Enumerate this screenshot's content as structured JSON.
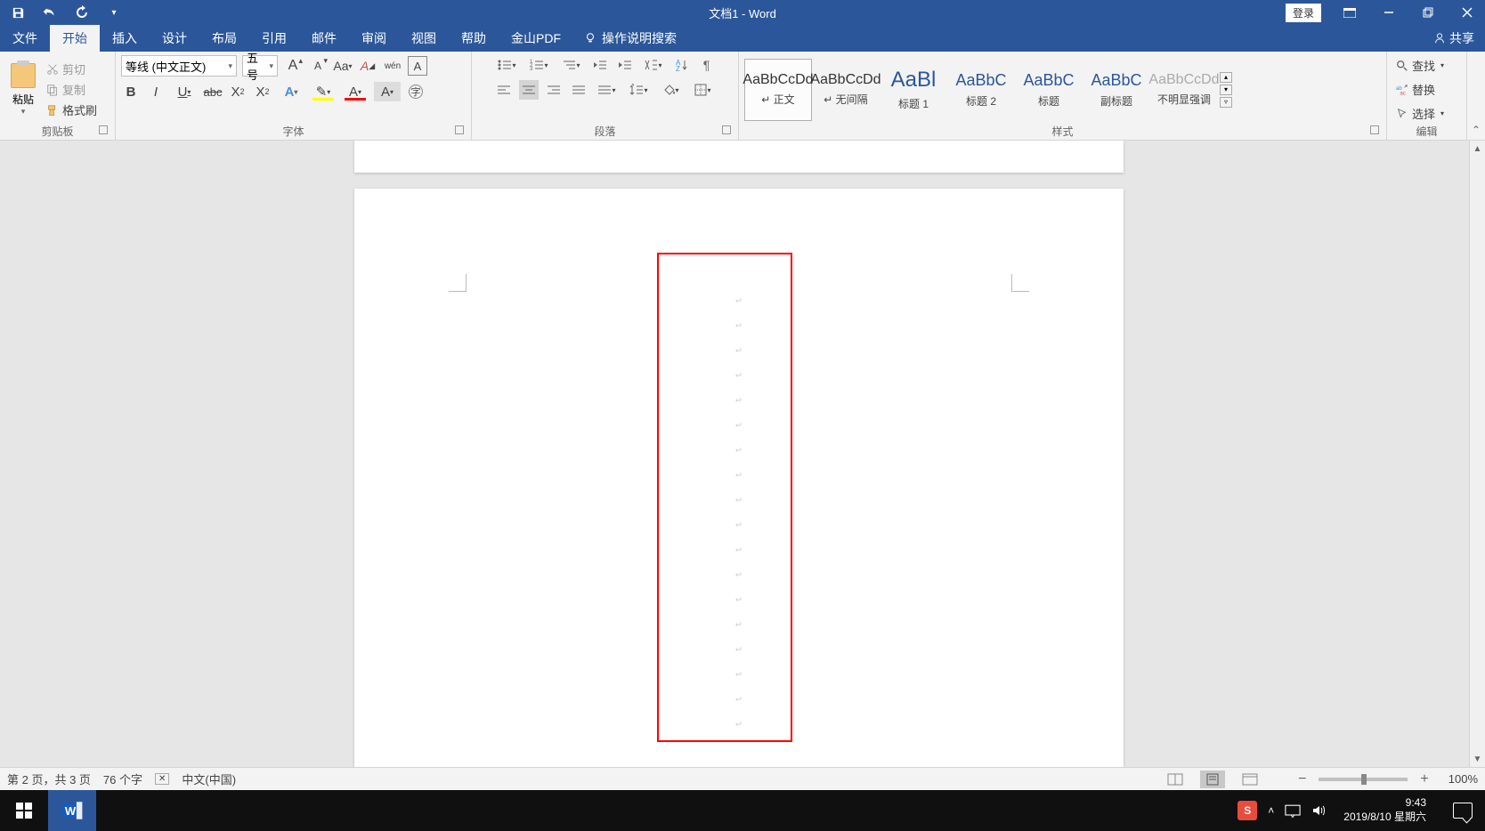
{
  "titlebar": {
    "title": "文档1 - Word",
    "login": "登录"
  },
  "tabs": {
    "file": "文件",
    "home": "开始",
    "insert": "插入",
    "design": "设计",
    "layout": "布局",
    "references": "引用",
    "mailings": "邮件",
    "review": "审阅",
    "view": "视图",
    "help": "帮助",
    "jinshan": "金山PDF",
    "tell_me": "操作说明搜索",
    "share": "共享"
  },
  "ribbon": {
    "clipboard": {
      "label": "剪贴板",
      "paste": "粘贴",
      "cut": "剪切",
      "copy": "复制",
      "format_painter": "格式刷"
    },
    "font": {
      "label": "字体",
      "name": "等线 (中文正文)",
      "size": "五号"
    },
    "paragraph": {
      "label": "段落"
    },
    "styles": {
      "label": "样式",
      "items": [
        {
          "preview": "AaBbCcDd",
          "name": "正文",
          "cls": "",
          "selected": true,
          "prefix": "↵"
        },
        {
          "preview": "AaBbCcDd",
          "name": "无间隔",
          "cls": "",
          "selected": false,
          "prefix": "↵"
        },
        {
          "preview": "AaBl",
          "name": "标题 1",
          "cls": "big",
          "selected": false,
          "prefix": ""
        },
        {
          "preview": "AaBbC",
          "name": "标题 2",
          "cls": "med",
          "selected": false,
          "prefix": ""
        },
        {
          "preview": "AaBbC",
          "name": "标题",
          "cls": "med",
          "selected": false,
          "prefix": ""
        },
        {
          "preview": "AaBbC",
          "name": "副标题",
          "cls": "med",
          "selected": false,
          "prefix": ""
        },
        {
          "preview": "AaBbCcDd",
          "name": "不明显强调",
          "cls": "gray",
          "selected": false,
          "prefix": ""
        }
      ]
    },
    "edit": {
      "label": "编辑",
      "find": "查找",
      "replace": "替换",
      "select": "选择"
    }
  },
  "status": {
    "page": "第 2 页，共 3 页",
    "words": "76 个字",
    "lang": "中文(中国)",
    "zoom": "100%"
  },
  "taskbar": {
    "time": "9:43",
    "date": "2019/8/10 星期六",
    "ime": "S"
  }
}
